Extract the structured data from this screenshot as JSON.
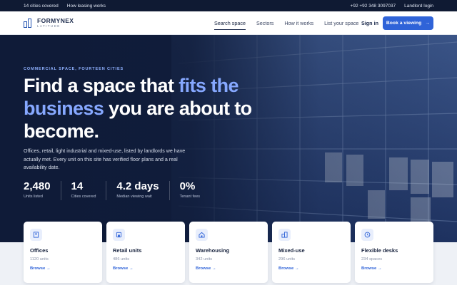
{
  "topbar": {
    "left": [
      "14 cities covered",
      "How leasing works"
    ],
    "phone": "+92 +92 348 3097037",
    "landlord": "Landlord login"
  },
  "brand": {
    "name": "FORMYNEX",
    "tagline": "LATITUDE"
  },
  "nav": {
    "items": [
      "Search space",
      "Sectors",
      "How it works",
      "List your space"
    ],
    "active": "Search space",
    "signin": "Sign in",
    "cta": "Book a viewing",
    "cta_arrow": "→"
  },
  "hero": {
    "eyebrow": "COMMERCIAL SPACE, FOURTEEN CITIES",
    "headline_1": "Find a space that ",
    "headline_hl_1": "fits the",
    "headline_hl_2": "business",
    "headline_2": " you are about to become.",
    "lede": "Offices, retail, light industrial and mixed-use, listed by landlords we have actually met. Every unit on this site has verified floor plans and a real availability date.",
    "stats": [
      {
        "value": "2,480",
        "label": "Units listed"
      },
      {
        "value": "14",
        "label": "Cities covered"
      },
      {
        "value": "4.2 days",
        "label": "Median viewing wait"
      },
      {
        "value": "0%",
        "label": "Tenant fees"
      }
    ]
  },
  "categories": [
    {
      "title": "Offices",
      "count": "1120 units",
      "link": "Browse",
      "icon": "office-building-icon"
    },
    {
      "title": "Retail units",
      "count": "486 units",
      "link": "Browse",
      "icon": "storefront-icon"
    },
    {
      "title": "Warehousing",
      "count": "342 units",
      "link": "Browse",
      "icon": "warehouse-icon"
    },
    {
      "title": "Mixed-use",
      "count": "296 units",
      "link": "Browse",
      "icon": "mixed-use-icon"
    },
    {
      "title": "Flexible desks",
      "count": "234 spaces",
      "link": "Browse",
      "icon": "clock-icon"
    }
  ],
  "link_arrow": "→",
  "colors": {
    "accent": "#2f63d8",
    "navy": "#0f1a33",
    "highlight": "#86a8ff"
  }
}
